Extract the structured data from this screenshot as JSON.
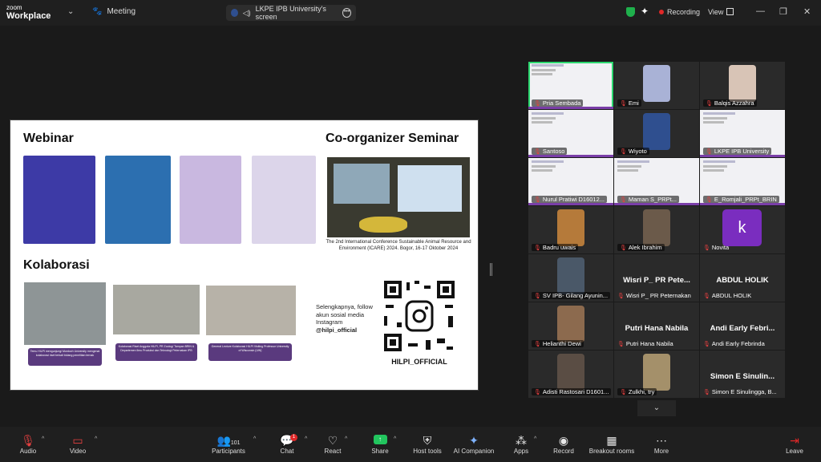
{
  "titlebar": {
    "brand_top": "zoom",
    "brand_bottom": "Workplace",
    "meeting_label": "Meeting",
    "share_label": "LKPE IPB University's screen",
    "recording_label": "Recording",
    "view_label": "View"
  },
  "slide": {
    "heading_webinar": "Webinar",
    "heading_coorg": "Co-organizer Seminar",
    "heading_kolaborasi": "Kolaborasi",
    "conf_caption": "The 2nd International Conference Sustainable Animal Resource and Environment (ICARE) 2024. Bogor, 16-17 Oktober 2024",
    "follow_text": "Selengkapnya, follow akun sosial media Instagram",
    "follow_handle": "@hilpi_official",
    "qr_label": "HILPI_OFFICIAL",
    "collab_captions": [
      "Temu HILPI mengunjungi Murdoch University mengenai kolaborasi riset terkait bidang penelitian ternak",
      "Kolaborasi Riset Anggota HILPI, PR Zoolog/ Tampan BRIN & Departemen Ilmu Produksi dan Teknologi Peternakan IPB",
      "General Lecture Kolaborasi HILPI Visiting Professor University of Wisconsin (UW)"
    ]
  },
  "participants": [
    {
      "name": "Pria Sembada",
      "kind": "slide",
      "active": true
    },
    {
      "name": "Emi",
      "kind": "face",
      "color": "#a9b2d6"
    },
    {
      "name": "Balqis Azzahra",
      "kind": "face",
      "color": "#d8c4b6"
    },
    {
      "name": "Santoso",
      "kind": "slide"
    },
    {
      "name": "Wiyoto",
      "kind": "face",
      "color": "#2f4f8f"
    },
    {
      "name": "LKPE IPB University",
      "kind": "slide"
    },
    {
      "name": "Nurul Pratiwi D16012...",
      "kind": "slide"
    },
    {
      "name": "Maman S_PRPt...",
      "kind": "slide"
    },
    {
      "name": "E_Romjali_PRPt_BRIN",
      "kind": "slide"
    },
    {
      "name": "Badru uwais",
      "kind": "face",
      "color": "#b57a3a"
    },
    {
      "name": "Alek Ibrahim",
      "kind": "face",
      "color": "#6b5a4a"
    },
    {
      "name": "Novita",
      "kind": "avatar",
      "initial": "k"
    },
    {
      "name": "SV IPB- Gilang Ayunin...",
      "kind": "face",
      "color": "#4a5868"
    },
    {
      "name": "Wisri P_ PR Peternakan",
      "kind": "name",
      "big": "Wisri P_ PR Pete..."
    },
    {
      "name": "ABDUL HOLIK",
      "kind": "name",
      "big": "ABDUL HOLIK"
    },
    {
      "name": "Helianthi Dewi",
      "kind": "face",
      "color": "#8c6a4e"
    },
    {
      "name": "Putri Hana Nabila",
      "kind": "name",
      "big": "Putri Hana Nabila"
    },
    {
      "name": "Andi Early Febrinda",
      "kind": "name",
      "big": "Andi Early Febri..."
    },
    {
      "name": "Adisti Rastosari D1601...",
      "kind": "face",
      "color": "#5a4d44"
    },
    {
      "name": "Zulkhi, try",
      "kind": "face",
      "color": "#a4906a"
    },
    {
      "name": "Simon E Sinulingga, B...",
      "kind": "name",
      "big": "Simon E Sinulin..."
    }
  ],
  "toolbar": {
    "audio": "Audio",
    "video": "Video",
    "participants_count": "101",
    "participants": "Participants",
    "chat": "Chat",
    "chat_badge": "1",
    "react": "React",
    "share": "Share",
    "host_tools": "Host tools",
    "ai_companion": "AI Companion",
    "apps": "Apps",
    "record": "Record",
    "breakout_rooms": "Breakout rooms",
    "more": "More",
    "leave": "Leave"
  },
  "icons": [
    "zoom-logo",
    "paw-icon",
    "shield-icon",
    "sparkle-icon",
    "record-dot-icon",
    "grid-icon",
    "minimize-icon",
    "restore-icon",
    "close-icon",
    "mic-muted-icon",
    "video-off-icon",
    "people-icon",
    "chat-icon",
    "heart-icon",
    "share-arrow-icon",
    "host-shield-icon",
    "ai-sparkle-icon",
    "apps-icon",
    "record-icon",
    "breakout-icon",
    "more-icon",
    "leave-icon",
    "chevron-down-icon"
  ]
}
